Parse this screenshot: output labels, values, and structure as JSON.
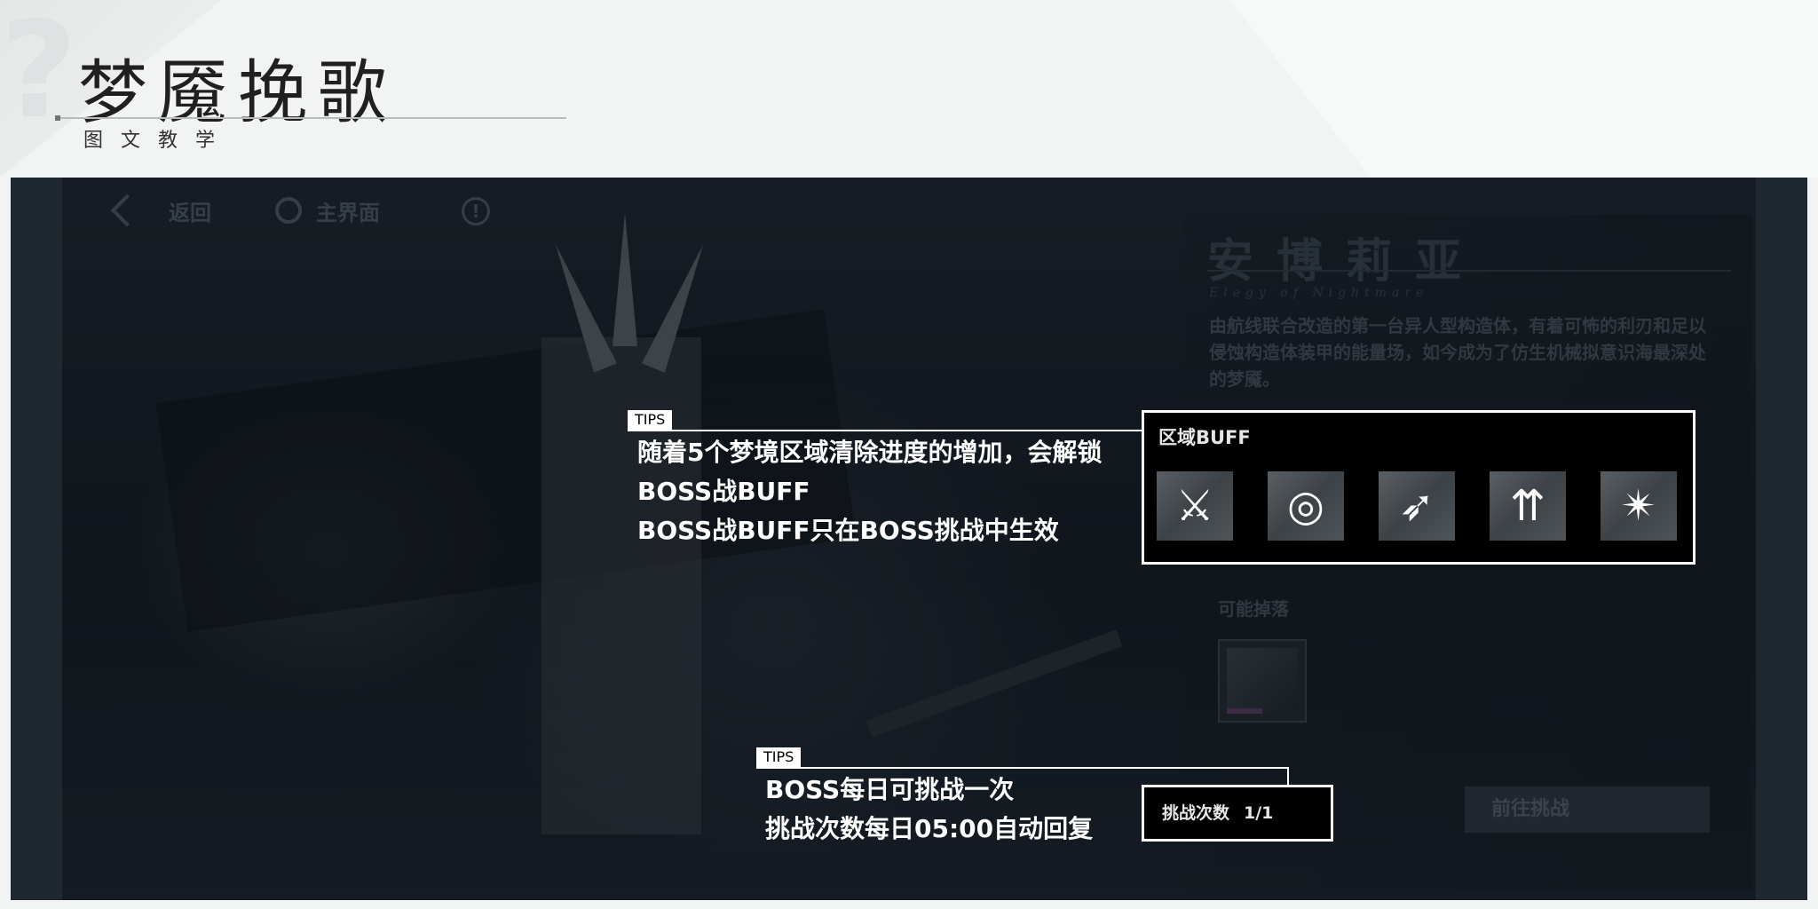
{
  "header": {
    "title": "梦魇挽歌",
    "subtitle": "图文教学"
  },
  "nav": {
    "back_label": "返回",
    "home_label": "主界面",
    "info_glyph": "!"
  },
  "boss": {
    "name": "安博莉亚",
    "name_sub": "Elegy of Nightmare",
    "description": "由航线联合改造的第一台异人型构造体，有着可怖的利刃和足以侵蚀构造体装甲的能量场，如今成为了仿生机械拟意识海最深处的梦魇。"
  },
  "buff": {
    "title": "区域BUFF",
    "icons": [
      {
        "name": "blade-slash-icon",
        "glyph": "⚔"
      },
      {
        "name": "ring-shield-icon",
        "glyph": "◎"
      },
      {
        "name": "dash-runner-icon",
        "glyph": "➶"
      },
      {
        "name": "triple-arrow-up-icon",
        "glyph": "⇈"
      },
      {
        "name": "claw-strike-icon",
        "glyph": "✴"
      }
    ]
  },
  "drops": {
    "label": "可能掉落"
  },
  "challenge": {
    "count_label": "挑战次数",
    "count_value": "1/1",
    "start_button": "前往挑战"
  },
  "tips": [
    {
      "tag": "TIPS",
      "lines": [
        "随着5个梦境区域清除进度的增加，会解锁",
        "BOSS战BUFF",
        "BOSS战BUFF只在BOSS挑战中生效"
      ]
    },
    {
      "tag": "TIPS",
      "lines": [
        "BOSS每日可挑战一次",
        "挑战次数每日05:00自动回复"
      ]
    }
  ],
  "colors": {
    "panel_bg": "#1b2229",
    "highlight_border": "#ffffff",
    "dim_text": "#45505a"
  }
}
